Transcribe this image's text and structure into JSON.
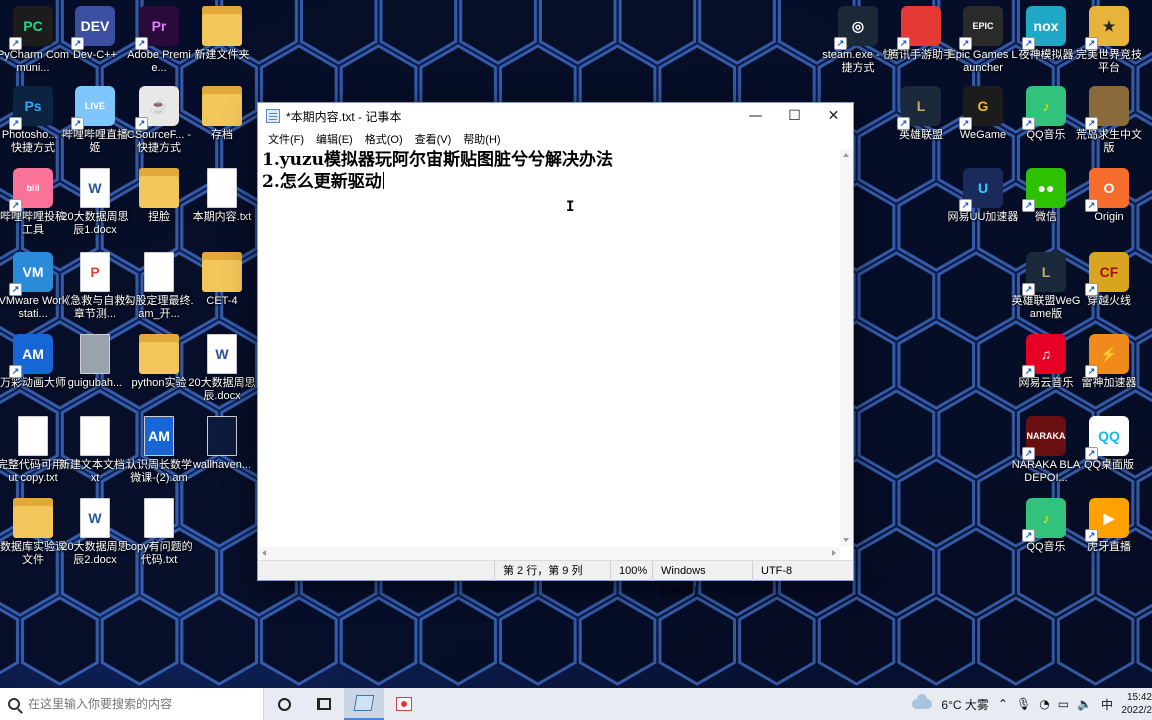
{
  "desktop": {
    "icons_left": [
      {
        "label": "PyCharm Communi...",
        "glyph": "PC",
        "color": "#1c1c1c",
        "accent": "#21d789",
        "icon": "pycharm-icon"
      },
      {
        "label": "Dev-C++",
        "glyph": "DEV",
        "color": "#3b4ea0",
        "accent": "#ffffff",
        "icon": "devcpp-icon"
      },
      {
        "label": "Adobe Premie...",
        "glyph": "Pr",
        "color": "#2a0a3a",
        "accent": "#e37cff",
        "icon": "premiere-icon"
      },
      {
        "label": "新建文件夹",
        "glyph": "",
        "color": "#f2c65a",
        "accent": "#ffffff",
        "icon": "folder-icon"
      },
      {
        "label": "Photosho... - 快捷方式",
        "glyph": "Ps",
        "color": "#0b2440",
        "accent": "#31a8ff",
        "icon": "photoshop-icon"
      },
      {
        "label": "哔哩哔哩直播姬",
        "glyph": "LIVE",
        "color": "#7fc6ff",
        "accent": "#ffffff",
        "icon": "bilibili-live-icon"
      },
      {
        "label": "CSourceF... - 快捷方式",
        "glyph": "☕",
        "color": "#e8e8e8",
        "accent": "#c0392b",
        "icon": "java-icon"
      },
      {
        "label": "存档",
        "glyph": "",
        "color": "#f2c65a",
        "accent": "#ffffff",
        "icon": "folder-icon"
      },
      {
        "label": "哔哩哔哩投稿工具",
        "glyph": "bili",
        "color": "#fb7299",
        "accent": "#ffffff",
        "icon": "bilibili-upload-icon"
      },
      {
        "label": "20大数据周思辰1.docx",
        "glyph": "W",
        "color": "#ffffff",
        "accent": "#2b579a",
        "icon": "word-doc-icon"
      },
      {
        "label": "捏脸",
        "glyph": "",
        "color": "#f2c65a",
        "accent": "#ffffff",
        "icon": "folder-icon"
      },
      {
        "label": "本期内容.txt",
        "glyph": "",
        "color": "#ffffff",
        "accent": "#999999",
        "icon": "text-file-icon"
      },
      {
        "label": "VMware Workstati...",
        "glyph": "VM",
        "color": "#2a8bd8",
        "accent": "#ffffff",
        "icon": "vmware-icon"
      },
      {
        "label": "《急救与自救》章节测...",
        "glyph": "P",
        "color": "#ffffff",
        "accent": "#e0443a",
        "icon": "pdf-file-icon"
      },
      {
        "label": "勾股定理最终.am_开...",
        "glyph": "",
        "color": "#ffffff",
        "accent": "#999999",
        "icon": "blank-file-icon"
      },
      {
        "label": "CET-4",
        "glyph": "",
        "color": "#f2c65a",
        "accent": "#ffffff",
        "icon": "folder-icon"
      },
      {
        "label": "万彩动画大师",
        "glyph": "AM",
        "color": "#1766d6",
        "accent": "#ffffff",
        "icon": "animation-master-icon"
      },
      {
        "label": "guigubah...",
        "glyph": "",
        "color": "#9aa3ad",
        "accent": "#ffffff",
        "icon": "image-file-icon"
      },
      {
        "label": "python实验",
        "glyph": "",
        "color": "#f2c65a",
        "accent": "#ffffff",
        "icon": "folder-icon"
      },
      {
        "label": "20大数据周思辰.docx",
        "glyph": "W",
        "color": "#ffffff",
        "accent": "#2b579a",
        "icon": "word-doc-icon"
      },
      {
        "label": "完整代码可用but copy.txt",
        "glyph": "",
        "color": "#ffffff",
        "accent": "#999999",
        "icon": "text-file-icon"
      },
      {
        "label": "新建文本文档.txt",
        "glyph": "",
        "color": "#ffffff",
        "accent": "#999999",
        "icon": "text-file-icon"
      },
      {
        "label": "认识周长数学微课-(2).am",
        "glyph": "AM",
        "color": "#1766d6",
        "accent": "#ffffff",
        "icon": "am-file-icon"
      },
      {
        "label": "wallhaven...",
        "glyph": "",
        "color": "#0e1a3a",
        "accent": "#ffffff",
        "icon": "image-file-icon"
      },
      {
        "label": "数据库实验课文件",
        "glyph": "",
        "color": "#f2c65a",
        "accent": "#ffffff",
        "icon": "folder-icon"
      },
      {
        "label": "20大数据周思辰2.docx",
        "glyph": "W",
        "color": "#ffffff",
        "accent": "#2b579a",
        "icon": "word-doc-icon"
      },
      {
        "label": "copy有问题的代码.txt",
        "glyph": "",
        "color": "#ffffff",
        "accent": "#999999",
        "icon": "text-file-icon"
      }
    ],
    "icons_right": [
      {
        "label": "steam.exe - 快捷方式",
        "glyph": "◎",
        "color": "#1b2838",
        "accent": "#ffffff",
        "icon": "steam-icon"
      },
      {
        "label": "腾讯手游助手",
        "glyph": "",
        "color": "#e53935",
        "accent": "#ffffff",
        "icon": "tencent-gaming-icon"
      },
      {
        "label": "Epic Games Launcher",
        "glyph": "EPIC",
        "color": "#2a2a2a",
        "accent": "#ffffff",
        "icon": "epic-games-icon"
      },
      {
        "label": "夜神模拟器",
        "glyph": "nox",
        "color": "#1fa8c6",
        "accent": "#ffffff",
        "icon": "nox-icon"
      },
      {
        "label": "完美世界竞技平台",
        "glyph": "★",
        "color": "#e8b33a",
        "accent": "#222222",
        "icon": "perfect-world-icon"
      },
      {
        "label": "英雄联盟",
        "glyph": "L",
        "color": "#1a2a3a",
        "accent": "#c8aa6e",
        "icon": "league-icon"
      },
      {
        "label": "WeGame",
        "glyph": "G",
        "color": "#1c1c1c",
        "accent": "#f2b632",
        "icon": "wegame-icon"
      },
      {
        "label": "QQ音乐",
        "glyph": "♪",
        "color": "#31c27c",
        "accent": "#ffde00",
        "icon": "qq-music-icon"
      },
      {
        "label": "荒岛求生中文版",
        "glyph": "",
        "color": "#8a6a3a",
        "accent": "#ffffff",
        "icon": "survival-game-icon"
      },
      {
        "label": "网易UU加速器",
        "glyph": "U",
        "color": "#1a2a5a",
        "accent": "#2ad1ff",
        "icon": "uu-accelerator-icon"
      },
      {
        "label": "微信",
        "glyph": "●●",
        "color": "#2dc100",
        "accent": "#ffffff",
        "icon": "wechat-icon"
      },
      {
        "label": "Origin",
        "glyph": "O",
        "color": "#f56c2d",
        "accent": "#ffffff",
        "icon": "origin-icon"
      },
      {
        "label": "英雄联盟WeGame版",
        "glyph": "L",
        "color": "#1a2a3a",
        "accent": "#c8aa6e",
        "icon": "league-wegame-icon"
      },
      {
        "label": "穿越火线",
        "glyph": "CF",
        "color": "#d9a520",
        "accent": "#a01010",
        "icon": "crossfire-icon"
      },
      {
        "label": "网易云音乐",
        "glyph": "♫",
        "color": "#e60026",
        "accent": "#ffffff",
        "icon": "netease-music-icon"
      },
      {
        "label": "雷神加速器",
        "glyph": "⚡",
        "color": "#f08a1c",
        "accent": "#ffffff",
        "icon": "thunder-accelerator-icon"
      },
      {
        "label": "NARAKA BLADEPOI...",
        "glyph": "NARAKA",
        "color": "#6a0f0f",
        "accent": "#ffffff",
        "icon": "naraka-icon"
      },
      {
        "label": "QQ桌面版",
        "glyph": "QQ",
        "color": "#ffffff",
        "accent": "#12b7f5",
        "icon": "qq-icon"
      },
      {
        "label": "QQ音乐",
        "glyph": "♪",
        "color": "#31c27c",
        "accent": "#ffde00",
        "icon": "qq-music-icon"
      },
      {
        "label": "虎牙直播",
        "glyph": "▶",
        "color": "#ffa200",
        "accent": "#ffffff",
        "icon": "huya-icon"
      }
    ]
  },
  "notepad": {
    "title": "*本期内容.txt - 记事本",
    "menu": [
      "文件(F)",
      "编辑(E)",
      "格式(O)",
      "查看(V)",
      "帮助(H)"
    ],
    "lines": [
      "1.yuzu模拟器玩阿尔宙斯贴图脏兮兮解决办法",
      "2.怎么更新驱动"
    ],
    "status": {
      "position": "第 2 行，第 9 列",
      "zoom": "100%",
      "line_ending": "Windows (CRLF)",
      "encoding": "UTF-8"
    },
    "cursor_glyph": "I"
  },
  "taskbar": {
    "search_placeholder": "在这里输入你要搜索的内容",
    "weather": "6°C  大雾",
    "ime": "中",
    "time": "15:42",
    "date": "2022/2"
  }
}
